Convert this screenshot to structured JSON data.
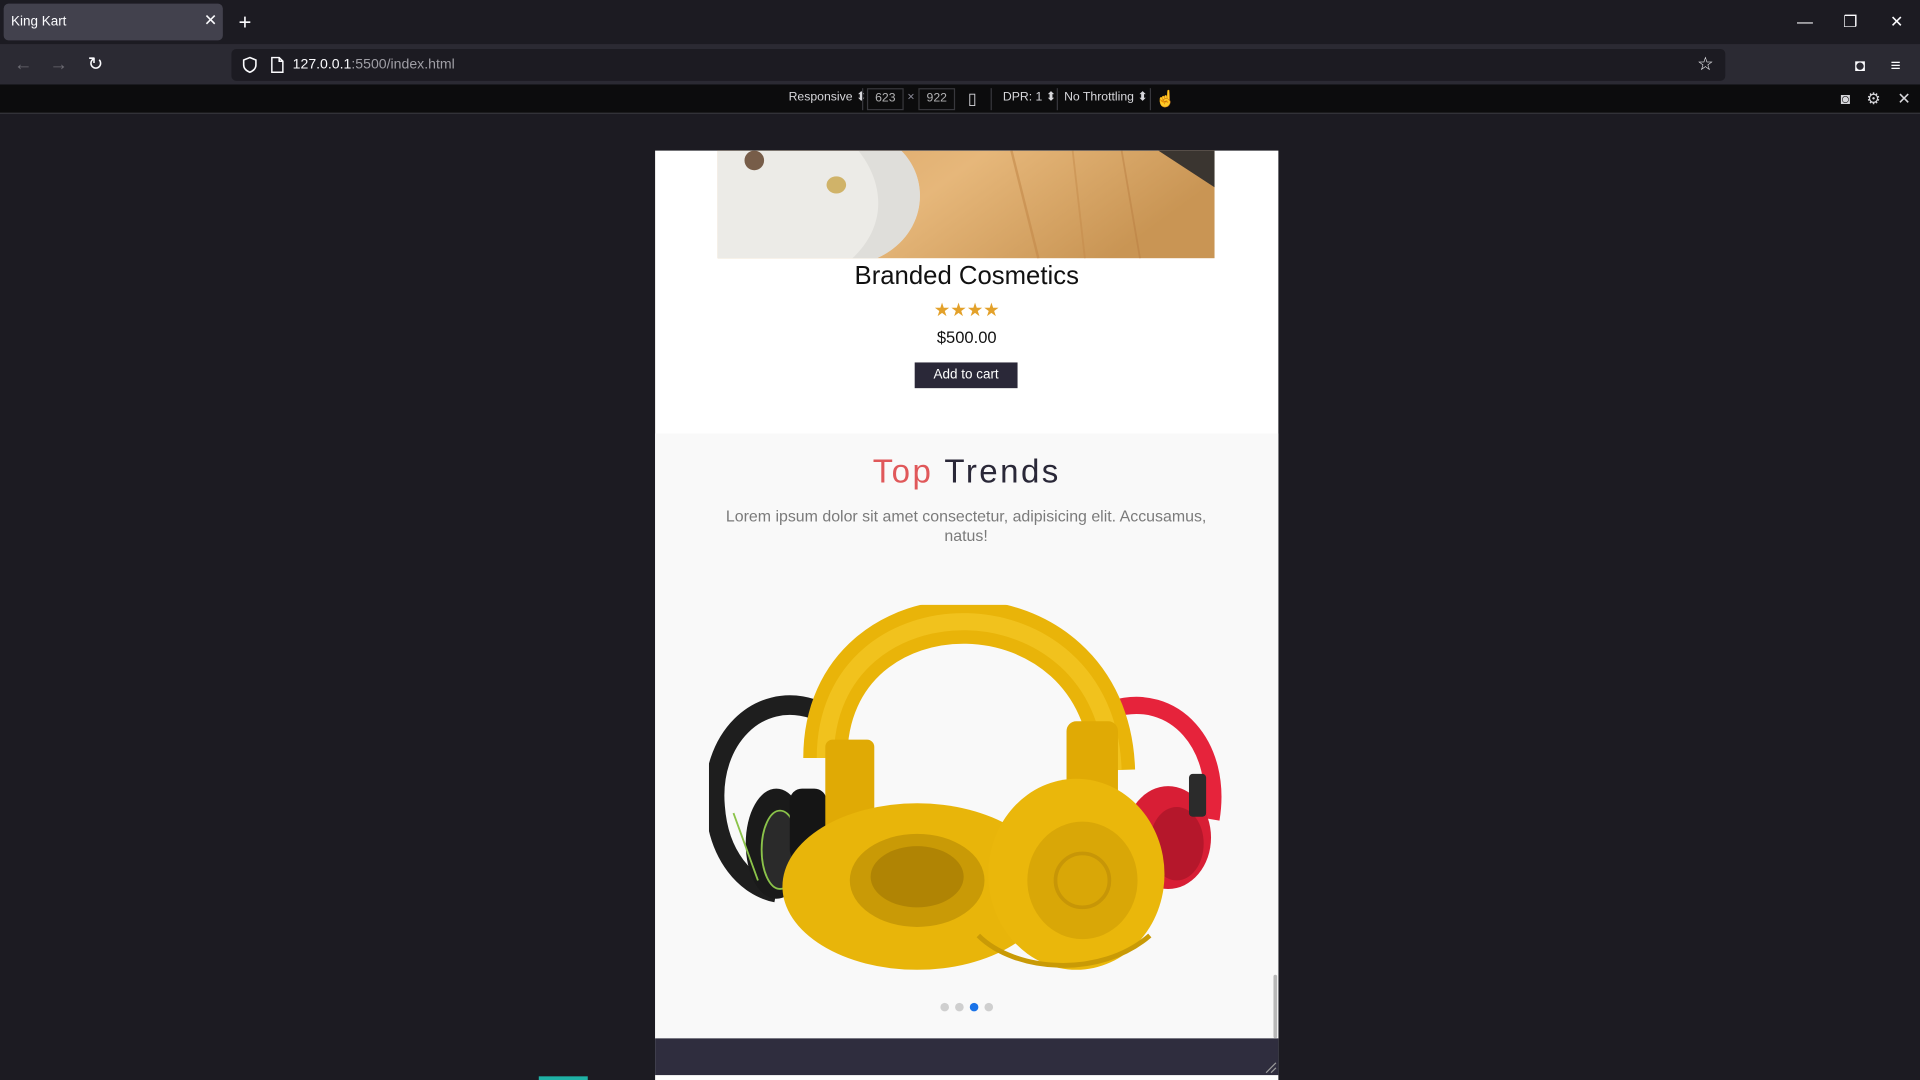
{
  "browser": {
    "tab_title": "King Kart",
    "url_host": "127.0.0.1",
    "url_rest": ":5500/index.html"
  },
  "rdm": {
    "device": "Responsive",
    "width": "623",
    "times": "×",
    "height": "922",
    "dpr": "DPR: 1",
    "throttling": "No Throttling"
  },
  "product": {
    "title": "Branded Cosmetics",
    "stars": "★★★★",
    "rating": 4,
    "price": "$500.00",
    "cart_label": "Add to cart"
  },
  "trends": {
    "title_accent": "Top",
    "title_rest": "Trends",
    "description": "Lorem ipsum dolor sit amet consectetur, adipisicing elit. Accusamus, natus!",
    "slide_count": 4,
    "active_slide": 3
  },
  "colors": {
    "accent": "#e0585a",
    "dark": "#2a2838",
    "star": "#e3a12a",
    "active_dot": "#1a73e8"
  }
}
